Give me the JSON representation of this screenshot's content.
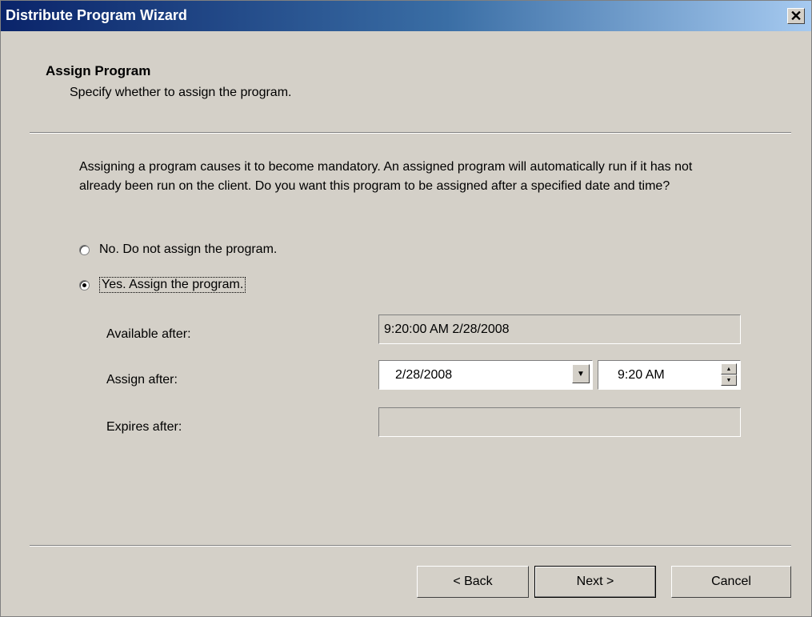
{
  "window": {
    "title": "Distribute Program Wizard",
    "close_label": "✕"
  },
  "header": {
    "title": "Assign Program",
    "subtitle": "Specify whether to assign the program."
  },
  "description": "Assigning a program causes it to become mandatory. An assigned program will automatically run if it has not already been run on the client. Do you want this program to be assigned after a specified date and time?",
  "options": {
    "no_label": "No. Do not assign the program.",
    "yes_label": "Yes. Assign the program.",
    "selected": "yes"
  },
  "fields": {
    "available_label": "Available after:",
    "available_value": "9:20:00 AM 2/28/2008",
    "assign_label": "Assign after:",
    "assign_date": "2/28/2008",
    "assign_time": "9:20 AM",
    "expires_label": "Expires after:",
    "expires_value": ""
  },
  "buttons": {
    "back": "< Back",
    "next": "Next >",
    "cancel": "Cancel"
  },
  "icons": {
    "close": "close-icon",
    "dropdown": "chevron-down-icon",
    "spin": "spinner-icon"
  }
}
